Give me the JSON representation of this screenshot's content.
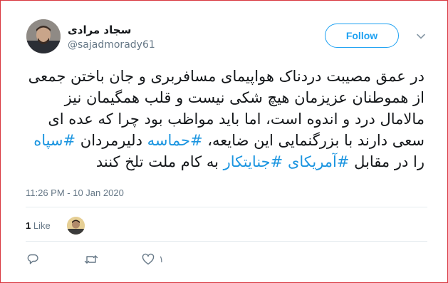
{
  "tweet": {
    "display_name": "سجاد مرادی",
    "handle": "@sajadmorady61",
    "follow_label": "Follow",
    "text_parts": [
      "در عمق مصیبت دردناک هواپیمای مسافربری و جان باختن جمعی از هموطنان عزیزمان هیچ شکی نیست و قلب همگیمان نیز مالامال درد و اندوه است، اما باید مواظب بود چرا که عده ای سعی دارند با بزرگنمایی این ضایعه، ",
      "#حماسه",
      " دلیرمردان ",
      "#سپاه",
      " را در مقابل ",
      "#آمریکای",
      " ",
      "#جنایتکار",
      " به کام ملت تلخ کنند"
    ],
    "timestamp": "11:26 PM - 10 Jan 2020",
    "likes_count": "1",
    "likes_label": "Like",
    "actions": {
      "reply": {
        "icon": "reply-icon"
      },
      "retweet": {
        "icon": "retweet-icon"
      },
      "like": {
        "icon": "heart-icon",
        "count": "۱"
      }
    }
  },
  "colors": {
    "accent": "#1da1f2",
    "hashtag": "#1b95e0",
    "muted": "#657786",
    "border": "#d9363e"
  }
}
